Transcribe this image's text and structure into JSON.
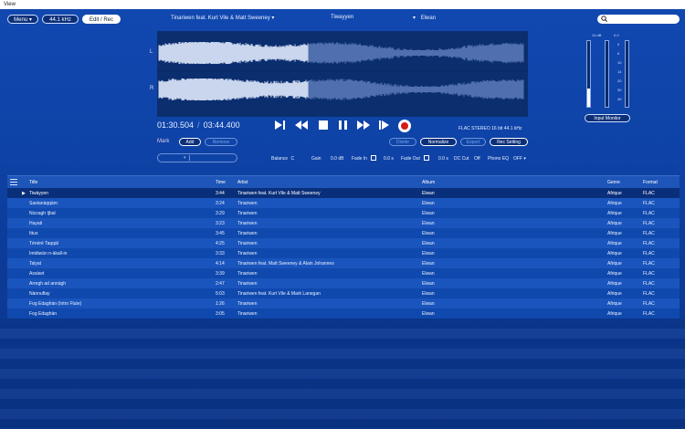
{
  "window": {
    "title": "View"
  },
  "topbar": {
    "menu_label": "Menu",
    "menu_arrow": "▾",
    "rate_label": "44.1 kHz",
    "mode_label": "Edit / Rec",
    "track_artist": "Tinariwen feat. Kurt Vile & Matt Sweeney",
    "track_title": "Tiwayyen",
    "track_album": "Elwan",
    "marker_symbol": "▾"
  },
  "waveform": {
    "left_label": "L",
    "right_label": "R",
    "played_fraction": 0.41
  },
  "meters": {
    "labels": [
      "10 dB",
      "0.0",
      "0",
      "6",
      "10",
      "14",
      "20",
      "30",
      "40"
    ],
    "input_monitor_label": "Input Monitor"
  },
  "transport": {
    "position": "01:30.504",
    "separator": "/",
    "duration": "03:44.400",
    "format": "FLAC STEREO 16 bit 44.1 kHz",
    "icons": [
      "skip-start-icon",
      "rewind-icon",
      "stop-icon",
      "pause-icon",
      "fast-forward-icon",
      "skip-end-icon",
      "record-icon"
    ]
  },
  "mark": {
    "label": "Mark",
    "add_label": "Add",
    "remove_label": "Remove",
    "divide_label": "Divide",
    "normalize_label": "Normalize",
    "export_label": "Export",
    "rec_setting_label": "Rec Setting"
  },
  "fx": {
    "balance_label": "Balance",
    "balance_value": "C",
    "gain_label": "Gain",
    "gain_value": "0.0 dB",
    "fade_in_label": "Fade In",
    "fade_in_value": "0.0 s",
    "fade_out_label": "Fade Out",
    "fade_out_value": "0.0 s",
    "dc_cut_label": "DC Cut",
    "dc_cut_value": "Off",
    "phono_eq_label": "Phono EQ",
    "phono_eq_value": "OFF"
  },
  "table": {
    "headers": {
      "title": "Title",
      "time": "Time",
      "artist": "Artist",
      "album": "Album",
      "genre": "Genre",
      "format": "Format"
    },
    "play_marker": "▶",
    "rows": [
      {
        "title": "Tiwàyyen",
        "time": "3:44",
        "artist": "Tinariwen feat. Kurt Vile & Matt Sweeney",
        "album": "Elwan",
        "genre": "Afrique",
        "format": "FLAC"
      },
      {
        "title": "Sastanàqqàm",
        "time": "3:24",
        "artist": "Tinariwen",
        "album": "Elwan",
        "genre": "Afrique",
        "format": "FLAC"
      },
      {
        "title": "Nizzagh Ijbal",
        "time": "3:29",
        "artist": "Tinariwen",
        "album": "Elwan",
        "genre": "Afrique",
        "format": "FLAC"
      },
      {
        "title": "Hayati",
        "time": "3:23",
        "artist": "Tinariwen",
        "album": "Elwan",
        "genre": "Afrique",
        "format": "FLAC"
      },
      {
        "title": "Ittus",
        "time": "3:45",
        "artist": "Tinariwen",
        "album": "Elwan",
        "genre": "Afrique",
        "format": "FLAC"
      },
      {
        "title": "Ténéré Taqqàl",
        "time": "4:25",
        "artist": "Tinariwen",
        "album": "Elwan",
        "genre": "Afrique",
        "format": "FLAC"
      },
      {
        "title": "Imidiwàn n-àkall-in",
        "time": "3:33",
        "artist": "Tinariwen",
        "album": "Elwan",
        "genre": "Afrique",
        "format": "FLAC"
      },
      {
        "title": "Talyat",
        "time": "4:14",
        "artist": "Tinariwen feat. Matt Sweeney & Alain Johannes",
        "album": "Elwan",
        "genre": "Afrique",
        "format": "FLAC"
      },
      {
        "title": "Assàwt",
        "time": "3:39",
        "artist": "Tinariwen",
        "album": "Elwan",
        "genre": "Afrique",
        "format": "FLAC"
      },
      {
        "title": "Arregh ad annàgh",
        "time": "2:47",
        "artist": "Tinariwen",
        "album": "Elwan",
        "genre": "Afrique",
        "format": "FLAC"
      },
      {
        "title": "Nànnuflay",
        "time": "5:03",
        "artist": "Tinariwen feat. Kurt Vile & Mark Lanegan",
        "album": "Elwan",
        "genre": "Afrique",
        "format": "FLAC"
      },
      {
        "title": "Fog Edaghàn (Intro Flute)",
        "time": "1:26",
        "artist": "Tinariwen",
        "album": "Elwan",
        "genre": "Afrique",
        "format": "FLAC"
      },
      {
        "title": "Fog Edaghàn",
        "time": "3:05",
        "artist": "Tinariwen",
        "album": "Elwan",
        "genre": "Afrique",
        "format": "FLAC"
      }
    ]
  },
  "colors": {
    "background": "#0e42a6",
    "waveform_played": "#c9d6ee",
    "waveform_unplayed": "#4f6fae",
    "record": "#d21c1c"
  }
}
